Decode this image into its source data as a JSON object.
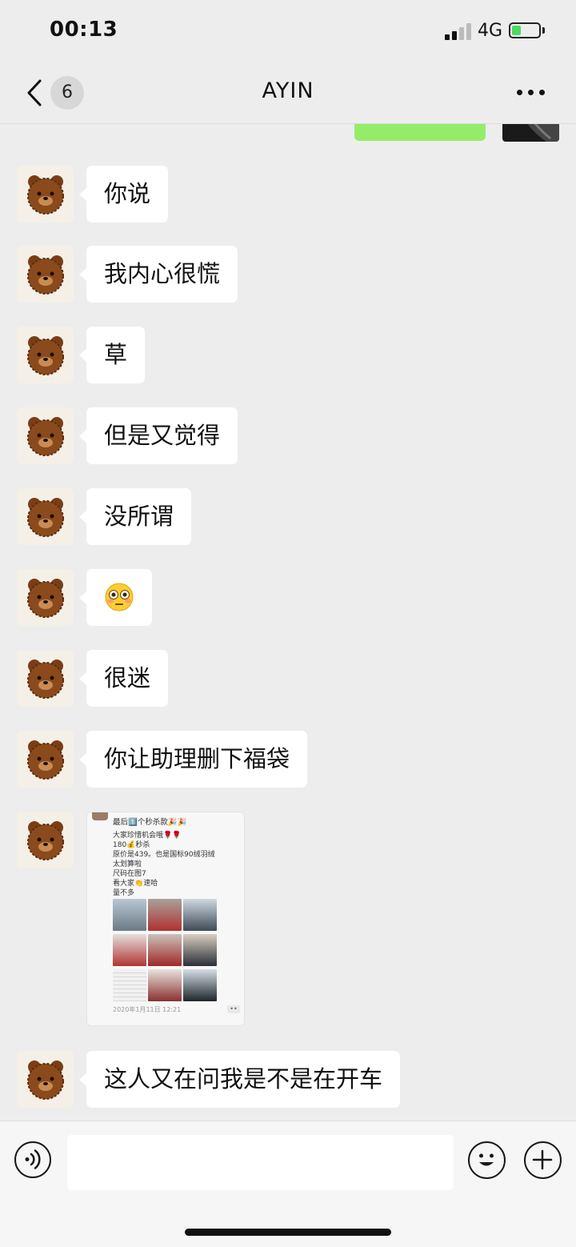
{
  "status_bar": {
    "time": "00:13",
    "network": "4G",
    "battery_level_fraction": 0.35,
    "battery_color": "#4cd964",
    "icons": [
      "signal-icon",
      "battery-icon"
    ]
  },
  "nav": {
    "back_icon": "chevron-left-icon",
    "unread_count": "6",
    "title": "AYIN",
    "more_icon": "ellipsis-icon"
  },
  "colors": {
    "background": "#ededed",
    "incoming_bubble": "#ffffff",
    "outgoing_bubble": "#95ec69",
    "text": "#111111"
  },
  "messages": [
    {
      "type": "text",
      "from": "contact",
      "text": "你说"
    },
    {
      "type": "text",
      "from": "contact",
      "text": "我内心很慌"
    },
    {
      "type": "text",
      "from": "contact",
      "text": "草"
    },
    {
      "type": "text",
      "from": "contact",
      "text": "但是又觉得"
    },
    {
      "type": "text",
      "from": "contact",
      "text": "没所谓"
    },
    {
      "type": "emoji",
      "from": "contact",
      "emoji": "flushed-face-emoji"
    },
    {
      "type": "text",
      "from": "contact",
      "text": "很迷"
    },
    {
      "type": "text",
      "from": "contact",
      "text": "你让助理删下福袋"
    },
    {
      "type": "image",
      "from": "contact",
      "screenshot": {
        "header": "最后1️⃣个秒杀款🎉🎉",
        "lines": [
          "大家珍惜机会哦🌹🌹",
          "180💰秒杀",
          "原价是439。也是国标90绒羽绒",
          "太划算啦",
          "尺码在图7",
          "看大家👏速哈",
          "量不多"
        ],
        "date": "2020年1月11日 12:21"
      }
    },
    {
      "type": "text",
      "from": "contact",
      "text": "这人又在问我是不是在开车"
    }
  ],
  "input_bar": {
    "voice_icon": "voice-icon",
    "emoji_icon": "smiley-icon",
    "plus_icon": "plus-icon",
    "input_value": ""
  }
}
